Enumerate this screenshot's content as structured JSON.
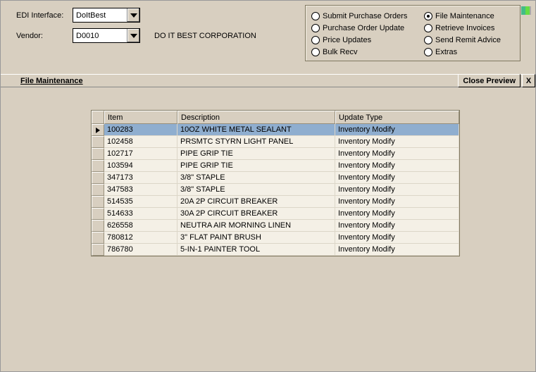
{
  "top": {
    "edi_label": "EDI Interface:",
    "edi_value": "DoItBest",
    "vendor_label": "Vendor:",
    "vendor_value": "D0010",
    "vendor_name": "DO IT BEST CORPORATION"
  },
  "options": {
    "left": [
      "Submit Purchase Orders",
      "Purchase Order Update",
      "Price Updates",
      "Bulk Recv"
    ],
    "right": [
      "File Maintenance",
      "Retrieve Invoices",
      "Send Remit Advice",
      "Extras"
    ],
    "selected": "File Maintenance"
  },
  "section": {
    "title": "File Maintenance",
    "close_label": "Close Preview",
    "x_label": "X"
  },
  "grid": {
    "headers": {
      "col0": "",
      "col1": "Item",
      "col2": "Description",
      "col3": "Update Type"
    },
    "rows": [
      {
        "item": "100283",
        "desc": "10OZ WHITE METAL SEALANT",
        "type": "Inventory Modify",
        "selected": true
      },
      {
        "item": "102458",
        "desc": "PRSMTC STYRN LIGHT PANEL",
        "type": "Inventory Modify",
        "selected": false
      },
      {
        "item": "102717",
        "desc": "PIPE GRIP TIE",
        "type": "Inventory Modify",
        "selected": false
      },
      {
        "item": "103594",
        "desc": "PIPE GRIP TIE",
        "type": "Inventory Modify",
        "selected": false
      },
      {
        "item": "347173",
        "desc": "3/8\" STAPLE",
        "type": "Inventory Modify",
        "selected": false
      },
      {
        "item": "347583",
        "desc": "3/8\" STAPLE",
        "type": "Inventory Modify",
        "selected": false
      },
      {
        "item": "514535",
        "desc": "20A 2P CIRCUIT BREAKER",
        "type": "Inventory Modify",
        "selected": false
      },
      {
        "item": "514633",
        "desc": "30A 2P CIRCUIT BREAKER",
        "type": "Inventory Modify",
        "selected": false
      },
      {
        "item": "626558",
        "desc": "NEUTRA AIR MORNING LINEN",
        "type": "Inventory Modify",
        "selected": false
      },
      {
        "item": "780812",
        "desc": "3\" FLAT PAINT BRUSH",
        "type": "Inventory Modify",
        "selected": false
      },
      {
        "item": "786780",
        "desc": "5-IN-1 PAINTER TOOL",
        "type": "Inventory Modify",
        "selected": false
      }
    ]
  }
}
